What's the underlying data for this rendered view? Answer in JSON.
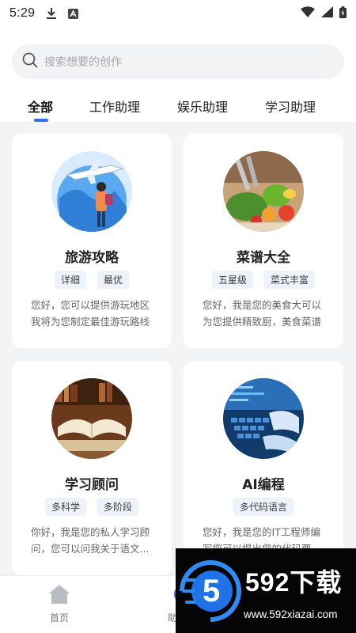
{
  "status_bar": {
    "time": "5:29"
  },
  "search": {
    "placeholder": "搜索想要的创作"
  },
  "tabs": [
    {
      "label": "全部",
      "active": true
    },
    {
      "label": "工作助理",
      "active": false
    },
    {
      "label": "娱乐助理",
      "active": false
    },
    {
      "label": "学习助理",
      "active": false
    }
  ],
  "cards": [
    {
      "title": "旅游攻略",
      "tags": [
        "详细",
        "最优"
      ],
      "desc_lines": [
        "您好，您可以提供游玩地区",
        "我将为您制定最佳游玩路线"
      ],
      "icon": "travel-illustration"
    },
    {
      "title": "菜谱大全",
      "tags": [
        "五星级",
        "菜式丰富"
      ],
      "desc_lines": [
        "您好，我是您的美食大可以",
        "为您提供精致厨，美食菜谱"
      ],
      "icon": "food-photo"
    },
    {
      "title": "学习顾问",
      "tags": [
        "多科学",
        "多阶段"
      ],
      "desc_lines": [
        "你好，我是您的私人学习顾",
        "问，您可以问我关于语文..."
      ],
      "icon": "book-photo"
    },
    {
      "title": "AI编程",
      "tags": [
        "多代码语言"
      ],
      "desc_lines": [
        "您好，我是您的IT工程师编",
        "写您可以提出您的代码要"
      ],
      "icon": "keyboard-photo"
    }
  ],
  "bottom_nav": [
    {
      "label": "首页",
      "icon": "home-icon"
    },
    {
      "label": "助",
      "icon": "assistant-icon"
    }
  ],
  "watermark": {
    "number": "5",
    "text": "592下载",
    "url": "www.592xiazai.com"
  },
  "colors": {
    "accent": "#2f6ef5",
    "background": "#f3f4f6",
    "tag_bg": "#eef3fb"
  }
}
